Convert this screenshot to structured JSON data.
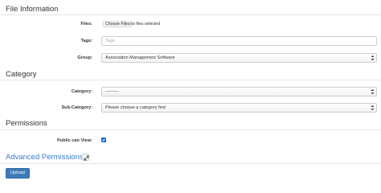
{
  "sections": {
    "file_information": "File Information",
    "category": "Category",
    "permissions": "Permissions",
    "advanced_permissions": "Advanced Permissions"
  },
  "files": {
    "label": "Files:",
    "button_label": "Choose Files",
    "status": "no files selected"
  },
  "tags": {
    "label": "Tags:",
    "placeholder": "Tags",
    "value": ""
  },
  "group": {
    "label": "Group:",
    "selected": "Association Management Software"
  },
  "category": {
    "label": "Category:",
    "selected": "---------"
  },
  "sub_category": {
    "label": "Sub-Category:",
    "selected": "Please choose a category first"
  },
  "public_can_view": {
    "label": "Public can View:",
    "checked": true
  },
  "actions": {
    "upload_label": "Upload"
  },
  "icons": {
    "select_arrows": "select-arrows-icon",
    "checkmark": "checkmark-icon",
    "expand": "expand-icon"
  },
  "colors": {
    "link_blue": "#3a7bc8",
    "button_blue": "#3d7ab8",
    "checkbox_blue": "#1e73e8"
  }
}
